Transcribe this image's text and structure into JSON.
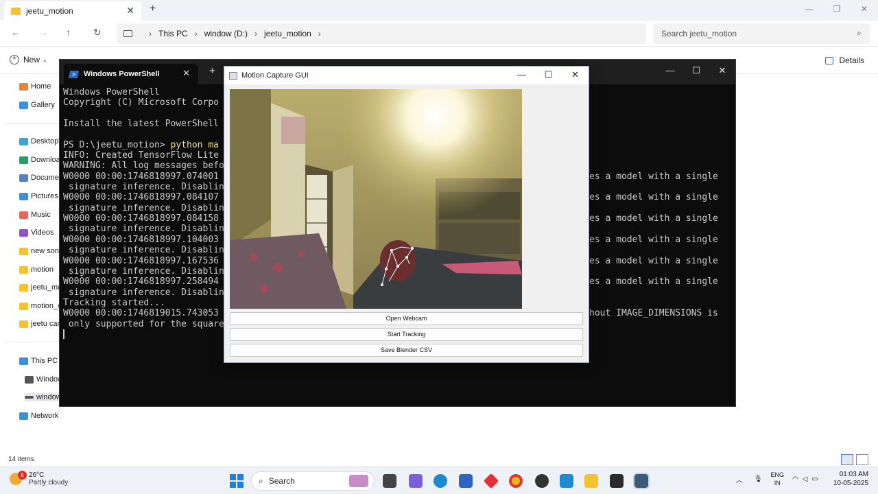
{
  "explorer": {
    "tab_title": "jeetu_motion",
    "breadcrumb": [
      "This PC",
      "window (D:)",
      "jeetu_motion"
    ],
    "search_placeholder": "Search jeetu_motion",
    "new_label": "New",
    "details_label": "Details",
    "nav_items": [
      {
        "label": "Home",
        "icon": "home-icon"
      },
      {
        "label": "Gallery",
        "icon": "gallery-icon"
      },
      {
        "label": "Desktop",
        "icon": "desktop-icon"
      },
      {
        "label": "Downloads",
        "icon": "download-icon"
      },
      {
        "label": "Documents",
        "icon": "document-icon"
      },
      {
        "label": "Pictures",
        "icon": "pictures-icon"
      },
      {
        "label": "Music",
        "icon": "music-icon"
      },
      {
        "label": "Videos",
        "icon": "videos-icon"
      },
      {
        "label": "new song",
        "icon": "folder-icon"
      },
      {
        "label": "motion",
        "icon": "folder-icon"
      },
      {
        "label": "jeetu_mo",
        "icon": "folder-icon"
      },
      {
        "label": "motion_c",
        "icon": "folder-icon"
      },
      {
        "label": "jeetu cam",
        "icon": "folder-icon"
      },
      {
        "label": "This PC",
        "icon": "pc-icon"
      },
      {
        "label": "Window",
        "icon": "drive-icon"
      },
      {
        "label": "window",
        "icon": "drive-icon"
      },
      {
        "label": "Network",
        "icon": "network-icon"
      }
    ],
    "items_count": "14 items"
  },
  "powershell": {
    "tab_title": "Windows PowerShell",
    "lines": [
      "Windows PowerShell",
      "Copyright (C) Microsoft Corpo",
      "",
      "Install the latest PowerShell",
      "",
      "PS D:\\jeetu_motion> ",
      "INFO: Created TensorFlow Lite",
      "WARNING: All log messages befo",
      "W0000 00:00:1746818997.074001",
      " signature inference. Disablin",
      "W0000 00:00:1746818997.084107",
      " signature inference. Disablin",
      "W0000 00:00:1746818997.084158",
      " signature inference. Disablin",
      "W0000 00:00:1746818997.104003",
      " signature inference. Disablin",
      "W0000 00:00:1746818997.167536",
      " signature inference. Disablin",
      "W0000 00:00:1746818997.258494",
      " signature inference. Disablin",
      "Tracking started...",
      "W0000 00:00:1746819015.743053",
      " only supported for the square"
    ],
    "command": "python ma",
    "right_lines": [
      "",
      "",
      "",
      "",
      "",
      "",
      "",
      "",
      "es a model with a single",
      "",
      "es a model with a single",
      "",
      "es a model with a single",
      "",
      "es a model with a single",
      "",
      "es a model with a single",
      "",
      "es a model with a single",
      "",
      "",
      "hout IMAGE_DIMENSIONS is",
      ""
    ]
  },
  "motion_gui": {
    "title": "Motion Capture GUI",
    "buttons": {
      "open": "Open Webcam",
      "start": "Start Tracking",
      "save": "Save Blender CSV"
    }
  },
  "taskbar": {
    "weather_temp": "26°C",
    "weather_desc": "Partly cloudy",
    "weather_badge": "5",
    "search_label": "Search",
    "lang": "ENG",
    "region": "IN",
    "time": "01:03 AM",
    "date": "10-05-2025"
  }
}
